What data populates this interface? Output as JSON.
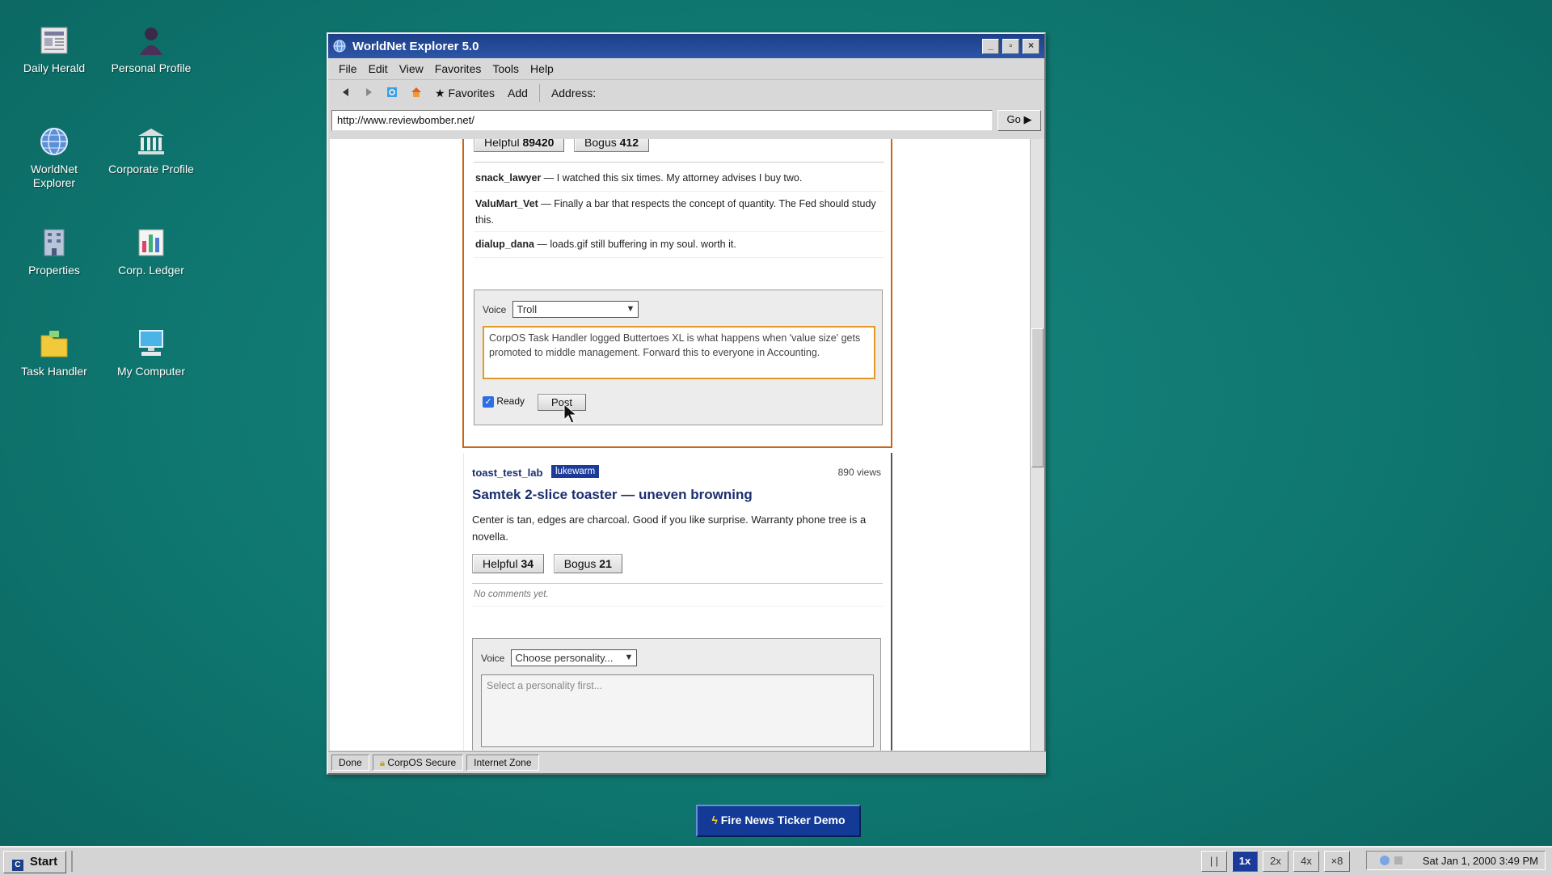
{
  "desktop": {
    "icons": [
      {
        "label": "Daily Herald",
        "icon": "newspaper-icon"
      },
      {
        "label": "Personal Profile",
        "icon": "person-icon"
      },
      {
        "label": "WorldNet Explorer",
        "icon": "globe-icon"
      },
      {
        "label": "Corporate Profile",
        "icon": "bank-icon"
      },
      {
        "label": "Properties",
        "icon": "building-icon"
      },
      {
        "label": "Corp. Ledger",
        "icon": "ledger-icon"
      },
      {
        "label": "Task Handler",
        "icon": "folder-icon"
      },
      {
        "label": "My Computer",
        "icon": "computer-icon"
      }
    ]
  },
  "window": {
    "title": "WorldNet Explorer 5.0",
    "controls": {
      "minimize": "_",
      "maximize": "▫",
      "close": "×"
    },
    "menu": [
      "File",
      "Edit",
      "View",
      "Favorites",
      "Tools",
      "Help"
    ],
    "toolbar": {
      "favorites": "★ Favorites",
      "add": "Add",
      "address_label": "Address:"
    },
    "address": "http://www.reviewbomber.net/",
    "go": "Go ▶",
    "status": [
      "Done",
      "CorpOS Secure",
      "Internet Zone"
    ]
  },
  "page": {
    "post1": {
      "helpful_label": "Helpful",
      "helpful_count": "89420",
      "bogus_label": "Bogus",
      "bogus_count": "412",
      "comments": [
        {
          "user": "snack_lawyer",
          "text": " — I watched this six times. My attorney advises I buy two."
        },
        {
          "user": "ValuMart_Vet",
          "text": " — Finally a bar that respects the concept of quantity. The Fed should study this."
        },
        {
          "user": "dialup_dana",
          "text": " — loads.gif still buffering in my soul. worth it."
        }
      ],
      "composer": {
        "voice_label": "Voice",
        "voice_value": "Troll",
        "text": "CorpOS Task Handler logged Buttertoes XL is what happens when 'value size' gets promoted to middle management. Forward this to everyone in Accounting.",
        "ready_label": "Ready",
        "ready_checked": true,
        "post_label": "Post"
      }
    },
    "post2": {
      "user": "toast_test_lab",
      "badge": "lukewarm",
      "views": "890 views",
      "title": "Samtek 2-slice toaster — uneven browning",
      "body": "Center is tan, edges are charcoal. Good if you like surprise. Warranty phone tree is a novella.",
      "helpful_label": "Helpful",
      "helpful_count": "34",
      "bogus_label": "Bogus",
      "bogus_count": "21",
      "no_comments": "No comments yet.",
      "composer": {
        "voice_label": "Voice",
        "voice_value": "Choose personality...",
        "placeholder": "Select a personality first..."
      }
    }
  },
  "ticker_button": "Fire News Ticker Demo",
  "taskbar": {
    "start": "Start",
    "speeds": [
      "| |",
      "1x",
      "2x",
      "4x",
      "×8"
    ],
    "active_speed": "1x",
    "clock": "Sat Jan 1, 2000 3:49 PM"
  },
  "colors": {
    "desktop": "#0f7a73",
    "titlebar": "#1c3f87",
    "accent_orange": "#c9651a",
    "badge": "#1b3a9a"
  }
}
